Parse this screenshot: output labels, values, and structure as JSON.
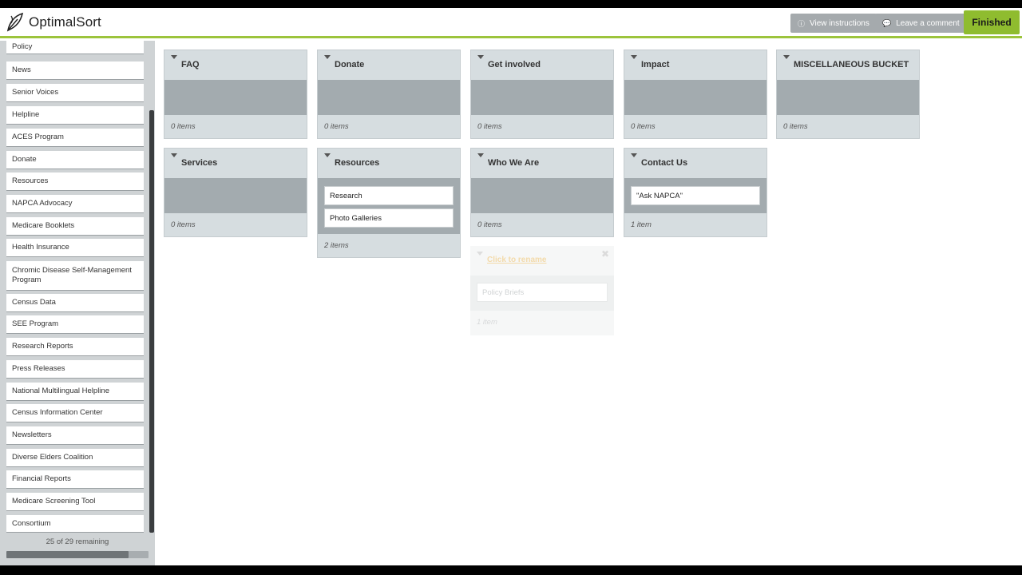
{
  "header": {
    "logo_text": "OptimalSort",
    "view_instructions": "View instructions",
    "leave_comment": "Leave a comment",
    "finished": "Finished",
    "accent_color": "#9cc43c"
  },
  "sidebar": {
    "cards": [
      "Policy",
      "News",
      "Senior Voices",
      "Helpline",
      "ACES Program",
      "Donate",
      "Resources",
      "NAPCA Advocacy",
      "Medicare Booklets",
      "Health Insurance",
      "Chromic Disease Self-Management Program",
      "Census Data",
      "SEE Program",
      "Research Reports",
      "Press Releases",
      "National Multilingual Helpline",
      "Census Information Center",
      "Newsletters",
      "Diverse Elders Coalition",
      "Financial Reports",
      "Medicare Screening Tool",
      "Consortium"
    ],
    "remaining_text": "25 of 29 remaining",
    "remaining_fraction": 0.862
  },
  "groups": [
    {
      "title": "FAQ",
      "items": [],
      "count": "0 items"
    },
    {
      "title": "Donate",
      "items": [],
      "count": "0 items"
    },
    {
      "title": "Get involved",
      "items": [],
      "count": "0 items"
    },
    {
      "title": "Impact",
      "items": [],
      "count": "0 items"
    },
    {
      "title": "MISCELLANEOUS BUCKET",
      "items": [],
      "count": "0 items"
    },
    {
      "title": "Services",
      "items": [],
      "count": "0 items"
    },
    {
      "title": "Resources",
      "items": [
        "Research",
        "Photo Galleries"
      ],
      "count": "2 items"
    },
    {
      "title": "Who We Are",
      "items": [],
      "count": "0 items"
    },
    {
      "title": "Contact Us",
      "items": [
        "\"Ask NAPCA\""
      ],
      "count": "1 item"
    }
  ],
  "ghost_group": {
    "title": "Click to rename",
    "item": "Policy Briefs",
    "count": "1 item"
  }
}
